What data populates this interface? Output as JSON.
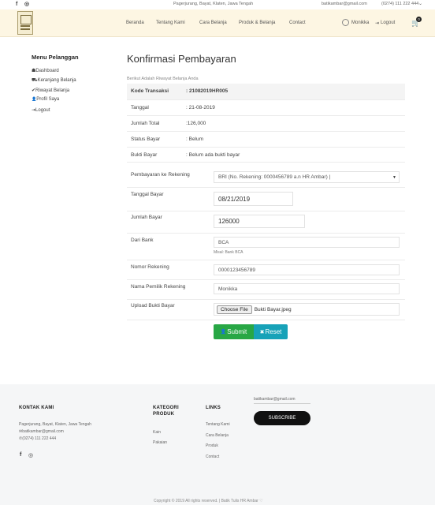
{
  "topbar": {
    "facebook_icon": "f",
    "instagram_icon": "◎",
    "address": "Pagerjurang, Bayat, Klaten, Jawa Tengah",
    "email": "batikambar@gmail.com",
    "phone": "(0274) 111 222 444"
  },
  "nav": {
    "items": [
      "Beranda",
      "Tentang Kami",
      "Cara Belanja",
      "Produk & Belanja",
      "Contact"
    ],
    "user": "Monikka",
    "logout": "Logout",
    "cart_count": "0"
  },
  "sidebar": {
    "title": "Menu Pelanggan",
    "items": [
      "Dashboard",
      "Keranjang Belanja",
      "Riwayat Belanja",
      "Profil Saya",
      "Logout"
    ],
    "icons": [
      "☗",
      "⛟",
      "✔",
      "👤",
      "⇥"
    ]
  },
  "main": {
    "title": "Konfirmasi Pembayaran",
    "subtitle": "Berikut Adalah Riwayat Belanja Anda",
    "details": [
      {
        "label": "Kode Transaksi",
        "value": ": 21082019HR005"
      },
      {
        "label": "Tanggal",
        "value": ": 21-08-2019"
      },
      {
        "label": "Jumlah Total",
        "value": ":126,000"
      },
      {
        "label": "Status Bayar",
        "value": ": Belum"
      },
      {
        "label": "Bukti Bayar",
        "value": ": Belum ada bukti bayar"
      }
    ]
  },
  "form": {
    "rekening_label": "Pembayaran ke Rekening",
    "rekening_value": "BRI (No. Rekening: 0000456789 a.n HR Ambar) |",
    "tanggal_label": "Tanggal Bayar",
    "tanggal_value": "08/21/2019",
    "jumlah_label": "Jumlah Bayar",
    "jumlah_value": "126000",
    "bank_label": "Dari Bank",
    "bank_value": "BCA",
    "bank_hint": "Misal: Bank BCA",
    "norek_label": "Nomor Rekening",
    "norek_value": "0000123456789",
    "pemilik_label": "Nama Pemilik Rekening",
    "pemilik_value": "Monikka",
    "upload_label": "Upload Bukti Bayar",
    "choose_file": "Choose File",
    "file_name": "Bukti Bayar.jpeg",
    "submit": "Submit",
    "reset": "Reset"
  },
  "footer": {
    "kontak_title": "KONTAK KAMI",
    "address": "Pagerjurang, Bayat, Klaten, Jawa Tengah",
    "email": "batikambar@gmail.com",
    "phone": "(0274) 111 222 444",
    "kategori_title_1": "KATEGORI",
    "kategori_title_2": "PRODUK",
    "kategori_items": [
      "Kain",
      "Pakaian"
    ],
    "links_title": "LINKS",
    "links_items": [
      "Tentang Kami",
      "Cara Belanja",
      "Produk",
      "Contact"
    ],
    "newsletter_email": "batikambar@gmail.com",
    "subscribe": "SUBSCRIBE",
    "copyright": "Copyright © 2019 All rights reserved. | Batik Tulis HR Ambar ♡"
  }
}
